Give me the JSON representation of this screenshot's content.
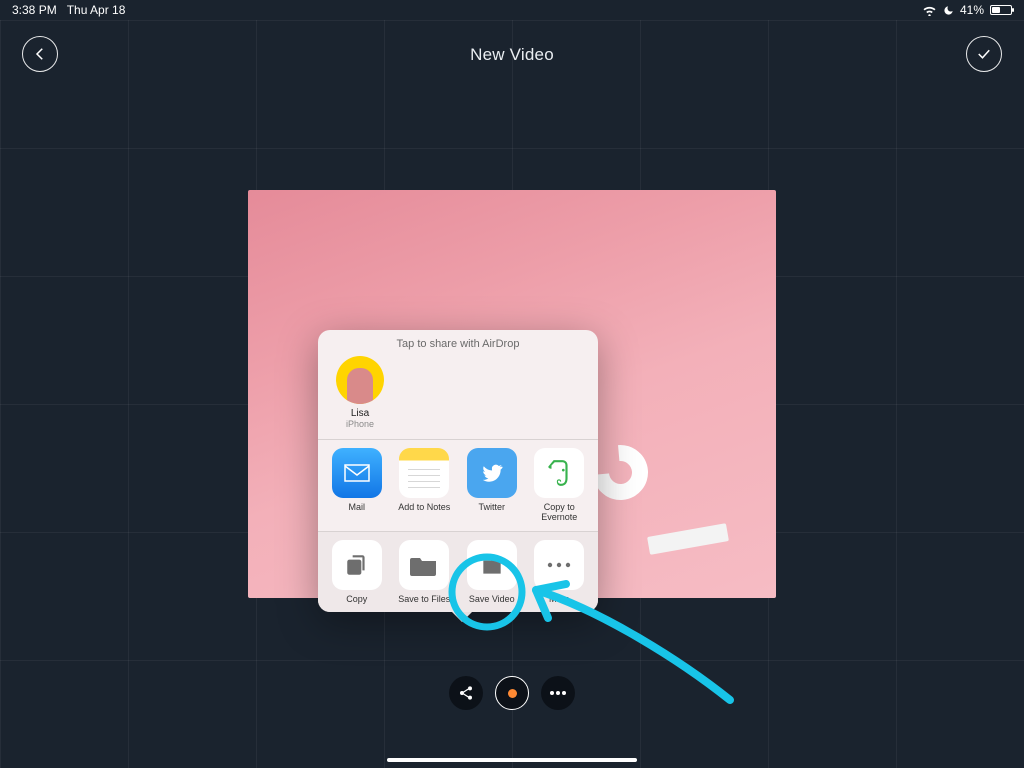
{
  "statusbar": {
    "time": "3:38 PM",
    "date": "Thu Apr 18",
    "battery_pct": "41%"
  },
  "header": {
    "title": "New Video"
  },
  "share_sheet": {
    "hint": "Tap to share with AirDrop",
    "airdrop": [
      {
        "name": "Lisa",
        "device": "iPhone"
      }
    ],
    "apps": [
      {
        "label": "Mail",
        "icon": "mail"
      },
      {
        "label": "Add to Notes",
        "icon": "notes"
      },
      {
        "label": "Twitter",
        "icon": "twitter"
      },
      {
        "label": "Copy to Evernote",
        "icon": "evernote"
      }
    ],
    "actions": [
      {
        "label": "Copy",
        "icon": "copy"
      },
      {
        "label": "Save to Files",
        "icon": "folder"
      },
      {
        "label": "Save Video",
        "icon": "save-video"
      },
      {
        "label": "More",
        "icon": "more"
      }
    ]
  },
  "toolbar": {
    "share_title": "Share",
    "more_title": "More"
  },
  "annotation": {
    "highlight_action": "Save Video",
    "color": "#18c4e8"
  }
}
